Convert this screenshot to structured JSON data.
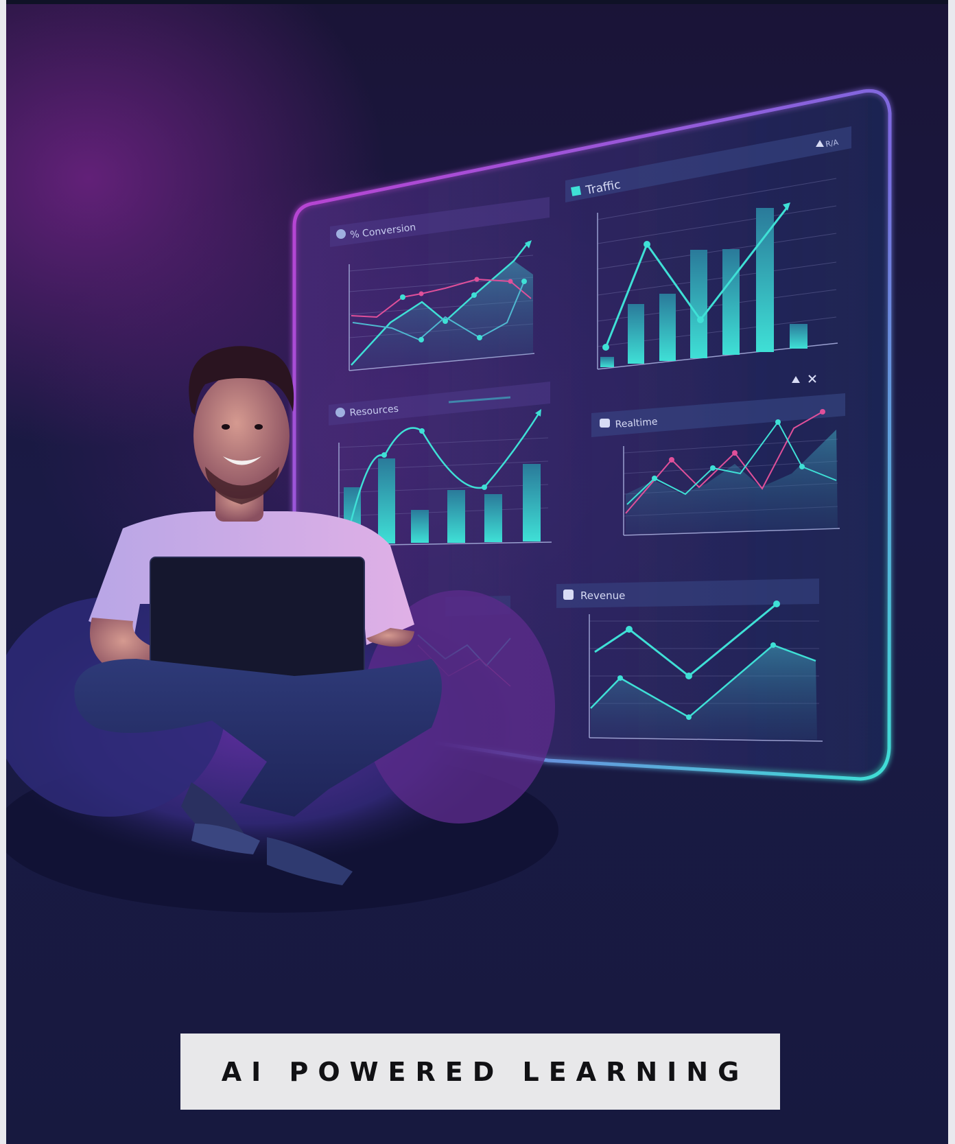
{
  "banner": {
    "text": "AI POWERED LEARNING"
  },
  "panels": {
    "conversion": {
      "title": "% Conversion"
    },
    "traffic": {
      "title": "Traffic",
      "corner": "R/A"
    },
    "resources": {
      "title": "Resources"
    },
    "realtime": {
      "title": "Realtime"
    },
    "revenue": {
      "title": "Revenue"
    }
  },
  "colors": {
    "background": "#1a1a45",
    "accent_purple": "#b43cc8",
    "accent_cyan": "#3fe0d6",
    "accent_pink": "#e0509a",
    "banner_bg": "#e8e8ea",
    "banner_text": "#111114"
  },
  "icons": [
    "gear-icon",
    "chart-icon",
    "people-icon",
    "close-icon",
    "camera-icon"
  ]
}
